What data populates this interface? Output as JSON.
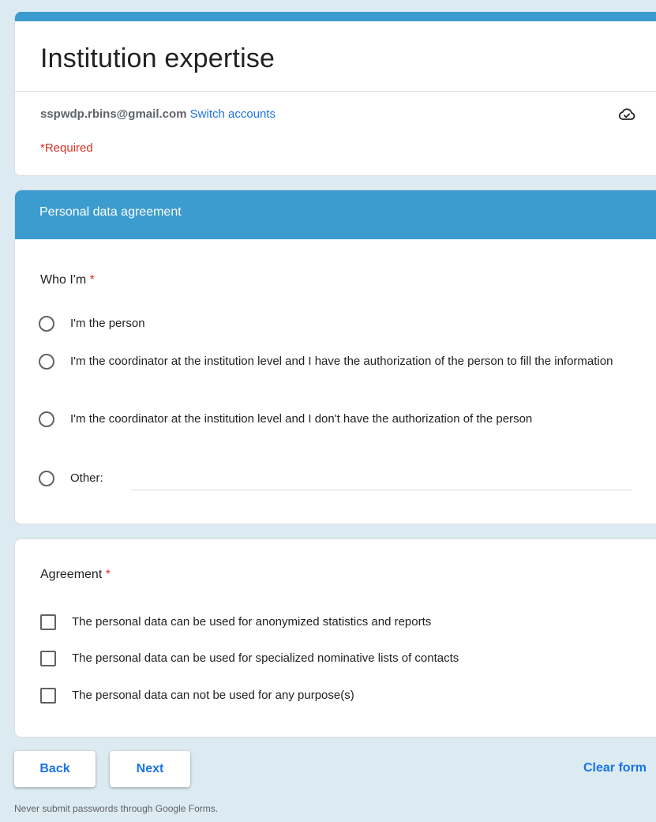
{
  "form": {
    "title": "Institution expertise",
    "email": "sspwdp.rbins@gmail.com",
    "switch_accounts": "Switch accounts",
    "required_note": "*Required",
    "cloud_icon": "cloud-done-icon"
  },
  "section": {
    "header": "Personal data agreement"
  },
  "who_question": {
    "title": "Who I'm",
    "asterisk": "*",
    "options": [
      "I'm the person",
      "I'm the coordinator at the institution level and I have the authorization of the person to fill the information",
      "I'm the coordinator at the institution level and I don't have the authorization of the person",
      "Other:"
    ],
    "other_value": ""
  },
  "agreement_question": {
    "title": "Agreement",
    "asterisk": "*",
    "options": [
      "The personal data can be used for anonymized statistics and reports",
      "The personal data can be used for specialized nominative lists of contacts",
      "The personal data can not be used for any purpose(s)"
    ]
  },
  "nav": {
    "back_label": "Back",
    "next_label": "Next",
    "clear_label": "Clear form"
  },
  "footer": {
    "note": "Never submit passwords through Google Forms."
  },
  "colors": {
    "accent": "#3d9ccf",
    "link": "#1a73e8",
    "required": "#d93025",
    "background": "#dcebf2"
  }
}
